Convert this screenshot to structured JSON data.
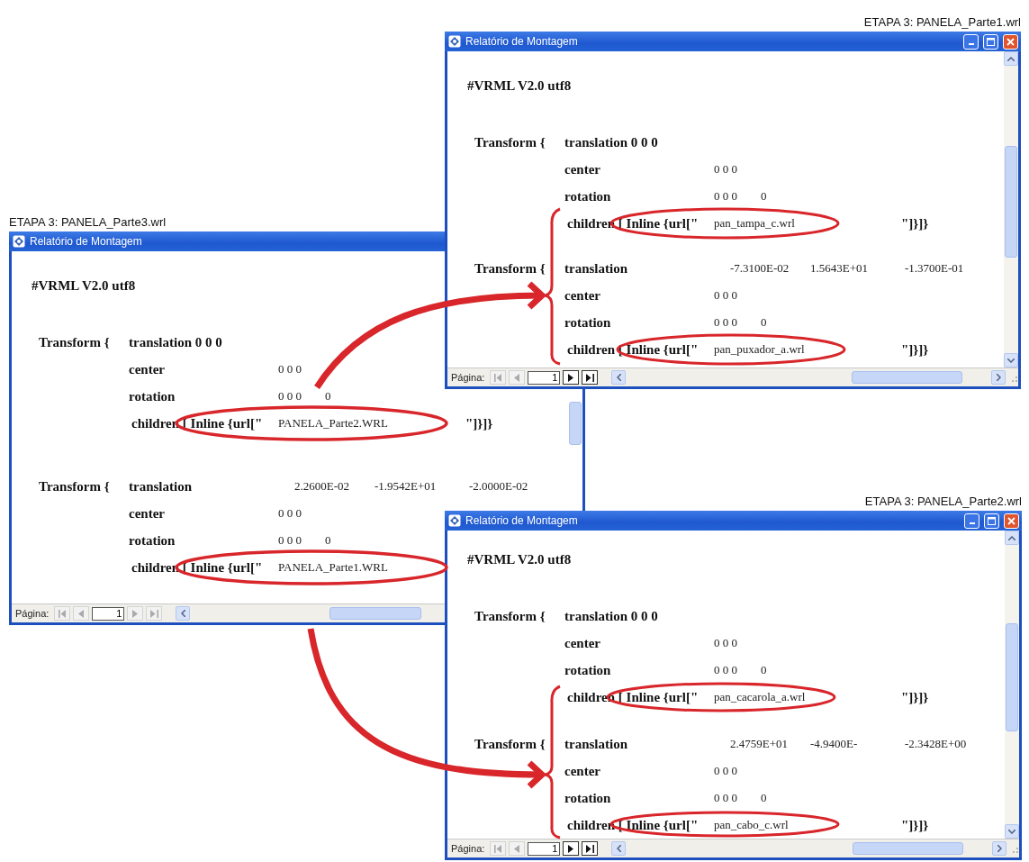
{
  "windows": [
    {
      "caption": "ETAPA 3: PANELA_Parte1.wrl",
      "title": "Relatório de Montagem",
      "header": "#VRML V2.0 utf8",
      "transforms": [
        {
          "keyword": "Transform {",
          "translation_label": "translation 0 0 0",
          "center_label": "center",
          "center_value": "0 0 0",
          "rotation_label": "rotation",
          "rotation_values": [
            "0 0 0",
            "0"
          ],
          "children_label": "children [ Inline {url[\"",
          "url": "pan_tampa_c.wrl",
          "closing": "\"]}]}"
        },
        {
          "keyword": "Transform {",
          "translation_label": "translation",
          "translation_values": [
            "-7.3100E-02",
            "1.5643E+01",
            "-1.3700E-01"
          ],
          "center_label": "center",
          "center_value": "0 0 0",
          "rotation_label": "rotation",
          "rotation_values": [
            "0 0 0",
            "0"
          ],
          "children_label": "children [ Inline {url[\"",
          "url": "pan_puxador_a.wrl",
          "closing": "\"]}]}"
        }
      ],
      "footer": {
        "label": "Página:",
        "page": "1",
        "nav_buttons": [
          {
            "kind": "first",
            "disabled": true
          },
          {
            "kind": "previous",
            "disabled": true
          },
          {
            "kind": "next",
            "disabled": false
          },
          {
            "kind": "last",
            "disabled": false
          }
        ]
      }
    },
    {
      "caption": "ETAPA 3: PANELA_Parte3.wrl",
      "title": "Relatório de Montagem",
      "header": "#VRML V2.0 utf8",
      "transforms": [
        {
          "keyword": "Transform {",
          "translation_label": "translation 0 0 0",
          "center_label": "center",
          "center_value": "0 0 0",
          "rotation_label": "rotation",
          "rotation_values": [
            "0 0 0",
            "0"
          ],
          "children_label": "children [ Inline {url[\"",
          "url": "PANELA_Parte2.WRL",
          "closing": "\"]}]}"
        },
        {
          "keyword": "Transform {",
          "translation_label": "translation",
          "translation_values": [
            "2.2600E-02",
            "-1.9542E+01",
            "-2.0000E-02"
          ],
          "center_label": "center",
          "center_value": "0 0 0",
          "rotation_label": "rotation",
          "rotation_values": [
            "0 0 0",
            "0"
          ],
          "children_label": "children [ Inline {url[\"",
          "url": "PANELA_Parte1.WRL"
        }
      ],
      "footer": {
        "label": "Página:",
        "page": "1",
        "nav_buttons": [
          {
            "kind": "first",
            "disabled": true
          },
          {
            "kind": "previous",
            "disabled": true
          },
          {
            "kind": "next",
            "disabled": true
          },
          {
            "kind": "last",
            "disabled": true
          }
        ]
      }
    },
    {
      "caption": "ETAPA 3: PANELA_Parte2.wrl",
      "title": "Relatório de Montagem",
      "header": "#VRML V2.0 utf8",
      "transforms": [
        {
          "keyword": "Transform {",
          "translation_label": "translation 0 0 0",
          "center_label": "center",
          "center_value": "0 0 0",
          "rotation_label": "rotation",
          "rotation_values": [
            "0 0 0",
            "0"
          ],
          "children_label": "children [ Inline {url[\"",
          "url": "pan_cacarola_a.wrl",
          "closing": "\"]}]}"
        },
        {
          "keyword": "Transform {",
          "translation_label": "translation",
          "translation_values": [
            "2.4759E+01",
            "-4.9400E-",
            "-2.3428E+00"
          ],
          "center_label": "center",
          "center_value": "0 0 0",
          "rotation_label": "rotation",
          "rotation_values": [
            "0 0 0",
            "0"
          ],
          "children_label": "children [ Inline {url[\"",
          "url": "pan_cabo_c.wrl",
          "closing": "\"]}]}"
        }
      ],
      "footer": {
        "label": "Página:",
        "page": "1",
        "nav_buttons": [
          {
            "kind": "first",
            "disabled": true
          },
          {
            "kind": "previous",
            "disabled": true
          },
          {
            "kind": "next",
            "disabled": false
          },
          {
            "kind": "last",
            "disabled": false
          }
        ]
      }
    }
  ]
}
